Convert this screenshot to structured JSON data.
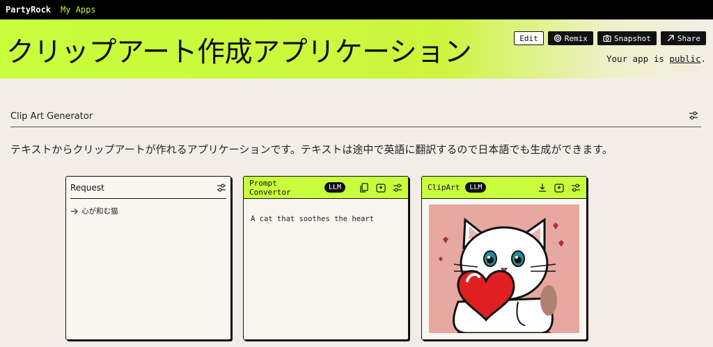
{
  "nav": {
    "brand": "PartyRock",
    "my_apps": "My Apps"
  },
  "header": {
    "title": "クリップアート作成アプリケーション",
    "buttons": {
      "edit": "Edit",
      "remix": "Remix",
      "snapshot": "Snapshot",
      "share": "Share"
    },
    "visibility_prefix": "Your app is ",
    "visibility_link": "public",
    "visibility_suffix": "."
  },
  "section": {
    "title": "Clip Art Generator",
    "description": "テキストからクリップアートが作れるアプリケーションです。テキストは途中で英語に翻訳するので日本語でも生成ができます。"
  },
  "cards": {
    "request": {
      "title": "Request",
      "entry": "心が和む猫"
    },
    "convertor": {
      "title_line1": "Prompt",
      "title_line2": "Convertor",
      "badge": "LLM",
      "output": "A cat that soothes the heart"
    },
    "clipart": {
      "title": "ClipArt",
      "badge": "LLM"
    }
  },
  "colors": {
    "accent": "#c8ff3c",
    "background": "#f2eee7",
    "dark": "#111111"
  }
}
